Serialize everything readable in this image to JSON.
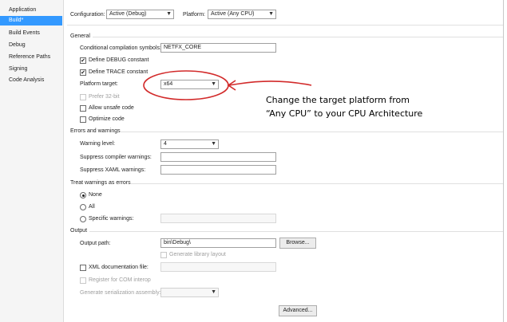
{
  "sidebar": {
    "items": [
      {
        "label": "Application"
      },
      {
        "label": "Build*"
      },
      {
        "label": "Build Events"
      },
      {
        "label": "Debug"
      },
      {
        "label": "Reference Paths"
      },
      {
        "label": "Signing"
      },
      {
        "label": "Code Analysis"
      }
    ],
    "selected_index": 1
  },
  "topbar": {
    "configuration_label": "Configuration:",
    "configuration_value": "Active (Debug)",
    "platform_label": "Platform:",
    "platform_value": "Active (Any CPU)"
  },
  "general": {
    "title": "General",
    "symbols_label": "Conditional compilation symbols:",
    "symbols_value": "NETFX_CORE",
    "define_debug_label": "Define DEBUG constant",
    "define_debug_checked": true,
    "define_trace_label": "Define TRACE constant",
    "define_trace_checked": true,
    "platform_target_label": "Platform target:",
    "platform_target_value": "x64",
    "prefer32_label": "Prefer 32-bit",
    "allow_unsafe_label": "Allow unsafe code",
    "optimize_label": "Optimize code"
  },
  "errors": {
    "title": "Errors and warnings",
    "warning_level_label": "Warning level:",
    "warning_level_value": "4",
    "suppress_compiler_label": "Suppress compiler warnings:",
    "suppress_xaml_label": "Suppress XAML warnings:"
  },
  "treat": {
    "title": "Treat warnings as errors",
    "none_label": "None",
    "all_label": "All",
    "specific_label": "Specific warnings:",
    "selected": "None"
  },
  "output": {
    "title": "Output",
    "output_path_label": "Output path:",
    "output_path_value": "bin\\Debug\\",
    "browse_label": "Browse...",
    "gen_library_label": "Generate library layout",
    "xml_doc_label": "XML documentation file:",
    "register_com_label": "Register for COM interop",
    "gen_serialization_label": "Generate serialization assembly:",
    "advanced_label": "Advanced..."
  },
  "annotation": {
    "text_line1": "Change the target platform from",
    "text_line2": "“Any CPU” to your CPU Architecture",
    "color": "#d22a2a"
  },
  "colors": {
    "selected_nav": "#3399ff",
    "annotation_red": "#d22a2a"
  }
}
